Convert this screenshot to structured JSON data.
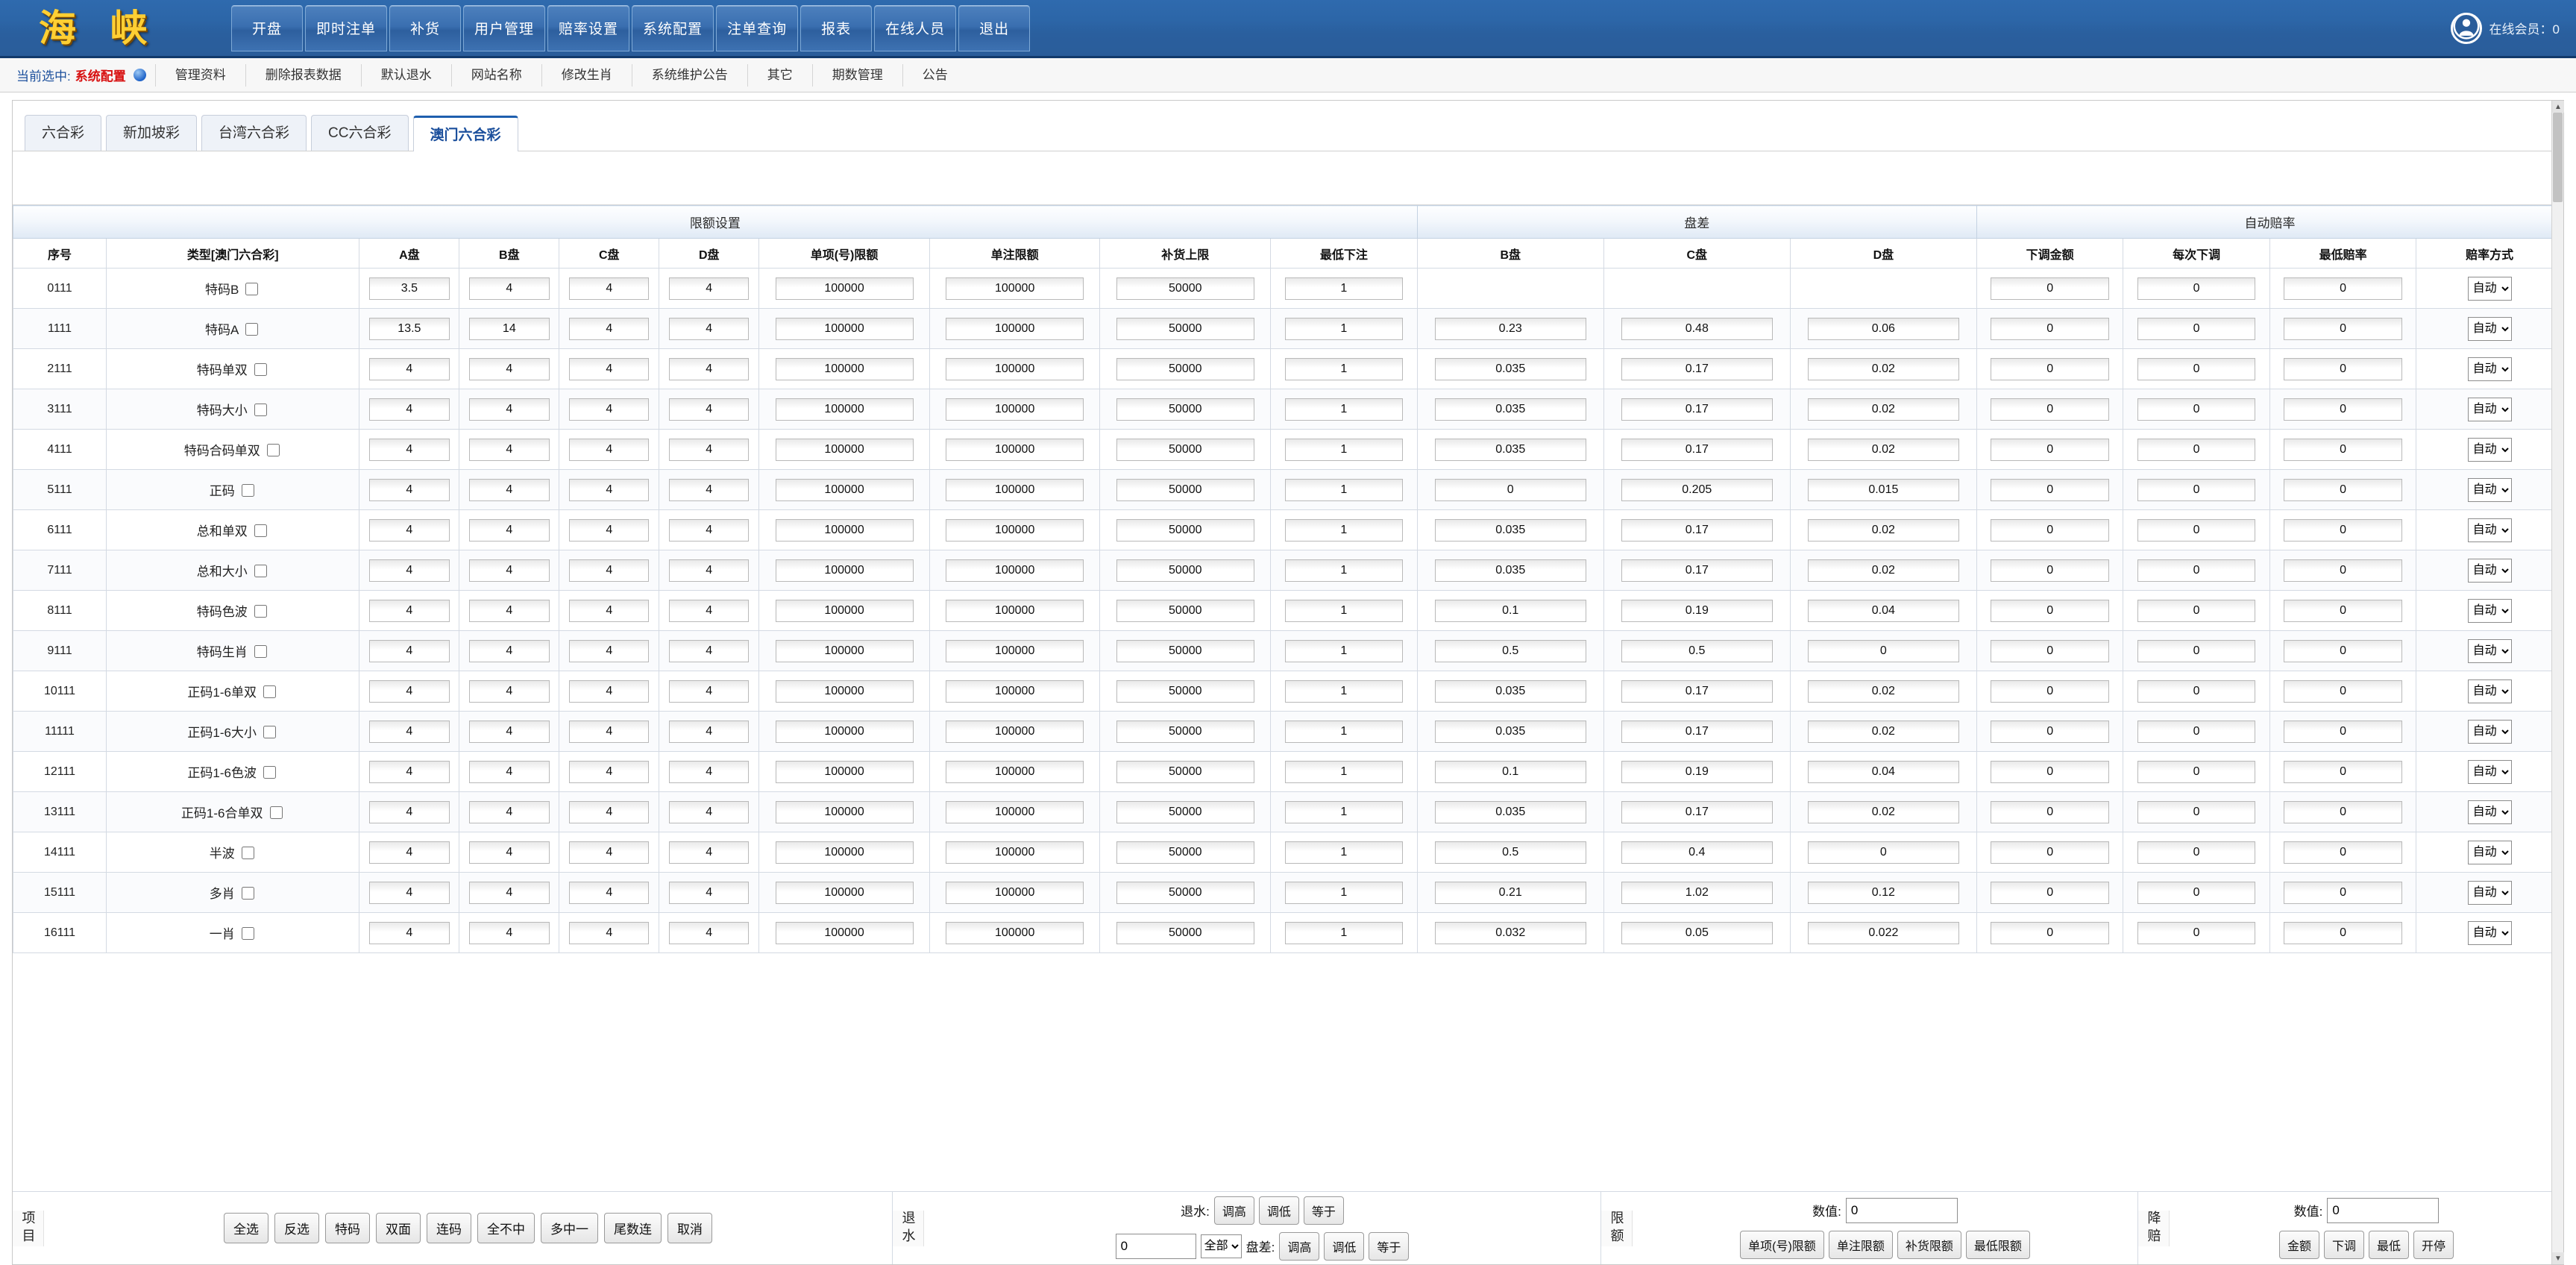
{
  "header": {
    "logo_text": "海 峡",
    "nav": [
      {
        "label": "开盘"
      },
      {
        "label": "即时注单"
      },
      {
        "label": "补货"
      },
      {
        "label": "用户管理"
      },
      {
        "label": "赔率设置"
      },
      {
        "label": "系统配置"
      },
      {
        "label": "注单查询"
      },
      {
        "label": "报表"
      },
      {
        "label": "在线人员"
      },
      {
        "label": "退出"
      }
    ],
    "online_label": "在线会员：0",
    "avatar_icon": "user-avatar-icon"
  },
  "subnav": {
    "current_label": "当前选中:",
    "current_value": "系统配置",
    "items": [
      {
        "label": "管理资料"
      },
      {
        "label": "删除报表数据"
      },
      {
        "label": "默认退水"
      },
      {
        "label": "网站名称"
      },
      {
        "label": "修改生肖"
      },
      {
        "label": "系统维护公告"
      },
      {
        "label": "其它"
      },
      {
        "label": "期数管理"
      },
      {
        "label": "公告"
      }
    ]
  },
  "tabs": [
    {
      "label": "六合彩",
      "active": false
    },
    {
      "label": "新加坡彩",
      "active": false
    },
    {
      "label": "台湾六合彩",
      "active": false
    },
    {
      "label": "CC六合彩",
      "active": false
    },
    {
      "label": "澳门六合彩",
      "active": true
    }
  ],
  "table": {
    "group_headers": [
      {
        "label": "限额设置",
        "span": 10
      },
      {
        "label": "盘差",
        "span": 3
      },
      {
        "label": "自动赔率",
        "span": 4
      }
    ],
    "columns": [
      "序号",
      "类型[澳门六合彩]",
      "A盘",
      "B盘",
      "C盘",
      "D盘",
      "单项(号)限额",
      "单注限额",
      "补货上限",
      "最低下注",
      "B盘",
      "C盘",
      "D盘",
      "下调金额",
      "每次下调",
      "最低赔率",
      "赔率方式"
    ],
    "mode_options": [
      "自动"
    ],
    "rows": [
      {
        "id": "0111",
        "type": "特码B",
        "a": "3.5",
        "b": "4",
        "c": "4",
        "d": "4",
        "single_item": "100000",
        "single_bet": "100000",
        "restock": "50000",
        "min_bet": "1",
        "pb": "",
        "pc": "",
        "pd": "",
        "down_amt": "0",
        "each_down": "0",
        "min_odds": "0",
        "mode": "自动"
      },
      {
        "id": "1111",
        "type": "特码A",
        "a": "13.5",
        "b": "14",
        "c": "4",
        "d": "4",
        "single_item": "100000",
        "single_bet": "100000",
        "restock": "50000",
        "min_bet": "1",
        "pb": "0.23",
        "pc": "0.48",
        "pd": "0.06",
        "down_amt": "0",
        "each_down": "0",
        "min_odds": "0",
        "mode": "自动"
      },
      {
        "id": "2111",
        "type": "特码单双",
        "a": "4",
        "b": "4",
        "c": "4",
        "d": "4",
        "single_item": "100000",
        "single_bet": "100000",
        "restock": "50000",
        "min_bet": "1",
        "pb": "0.035",
        "pc": "0.17",
        "pd": "0.02",
        "down_amt": "0",
        "each_down": "0",
        "min_odds": "0",
        "mode": "自动"
      },
      {
        "id": "3111",
        "type": "特码大小",
        "a": "4",
        "b": "4",
        "c": "4",
        "d": "4",
        "single_item": "100000",
        "single_bet": "100000",
        "restock": "50000",
        "min_bet": "1",
        "pb": "0.035",
        "pc": "0.17",
        "pd": "0.02",
        "down_amt": "0",
        "each_down": "0",
        "min_odds": "0",
        "mode": "自动"
      },
      {
        "id": "4111",
        "type": "特码合码单双",
        "a": "4",
        "b": "4",
        "c": "4",
        "d": "4",
        "single_item": "100000",
        "single_bet": "100000",
        "restock": "50000",
        "min_bet": "1",
        "pb": "0.035",
        "pc": "0.17",
        "pd": "0.02",
        "down_amt": "0",
        "each_down": "0",
        "min_odds": "0",
        "mode": "自动"
      },
      {
        "id": "5111",
        "type": "正码",
        "a": "4",
        "b": "4",
        "c": "4",
        "d": "4",
        "single_item": "100000",
        "single_bet": "100000",
        "restock": "50000",
        "min_bet": "1",
        "pb": "0",
        "pc": "0.205",
        "pd": "0.015",
        "down_amt": "0",
        "each_down": "0",
        "min_odds": "0",
        "mode": "自动"
      },
      {
        "id": "6111",
        "type": "总和单双",
        "a": "4",
        "b": "4",
        "c": "4",
        "d": "4",
        "single_item": "100000",
        "single_bet": "100000",
        "restock": "50000",
        "min_bet": "1",
        "pb": "0.035",
        "pc": "0.17",
        "pd": "0.02",
        "down_amt": "0",
        "each_down": "0",
        "min_odds": "0",
        "mode": "自动"
      },
      {
        "id": "7111",
        "type": "总和大小",
        "a": "4",
        "b": "4",
        "c": "4",
        "d": "4",
        "single_item": "100000",
        "single_bet": "100000",
        "restock": "50000",
        "min_bet": "1",
        "pb": "0.035",
        "pc": "0.17",
        "pd": "0.02",
        "down_amt": "0",
        "each_down": "0",
        "min_odds": "0",
        "mode": "自动"
      },
      {
        "id": "8111",
        "type": "特码色波",
        "a": "4",
        "b": "4",
        "c": "4",
        "d": "4",
        "single_item": "100000",
        "single_bet": "100000",
        "restock": "50000",
        "min_bet": "1",
        "pb": "0.1",
        "pc": "0.19",
        "pd": "0.04",
        "down_amt": "0",
        "each_down": "0",
        "min_odds": "0",
        "mode": "自动"
      },
      {
        "id": "9111",
        "type": "特码生肖",
        "a": "4",
        "b": "4",
        "c": "4",
        "d": "4",
        "single_item": "100000",
        "single_bet": "100000",
        "restock": "50000",
        "min_bet": "1",
        "pb": "0.5",
        "pc": "0.5",
        "pd": "0",
        "down_amt": "0",
        "each_down": "0",
        "min_odds": "0",
        "mode": "自动"
      },
      {
        "id": "10111",
        "type": "正码1-6单双",
        "a": "4",
        "b": "4",
        "c": "4",
        "d": "4",
        "single_item": "100000",
        "single_bet": "100000",
        "restock": "50000",
        "min_bet": "1",
        "pb": "0.035",
        "pc": "0.17",
        "pd": "0.02",
        "down_amt": "0",
        "each_down": "0",
        "min_odds": "0",
        "mode": "自动"
      },
      {
        "id": "11111",
        "type": "正码1-6大小",
        "a": "4",
        "b": "4",
        "c": "4",
        "d": "4",
        "single_item": "100000",
        "single_bet": "100000",
        "restock": "50000",
        "min_bet": "1",
        "pb": "0.035",
        "pc": "0.17",
        "pd": "0.02",
        "down_amt": "0",
        "each_down": "0",
        "min_odds": "0",
        "mode": "自动"
      },
      {
        "id": "12111",
        "type": "正码1-6色波",
        "a": "4",
        "b": "4",
        "c": "4",
        "d": "4",
        "single_item": "100000",
        "single_bet": "100000",
        "restock": "50000",
        "min_bet": "1",
        "pb": "0.1",
        "pc": "0.19",
        "pd": "0.04",
        "down_amt": "0",
        "each_down": "0",
        "min_odds": "0",
        "mode": "自动"
      },
      {
        "id": "13111",
        "type": "正码1-6合单双",
        "a": "4",
        "b": "4",
        "c": "4",
        "d": "4",
        "single_item": "100000",
        "single_bet": "100000",
        "restock": "50000",
        "min_bet": "1",
        "pb": "0.035",
        "pc": "0.17",
        "pd": "0.02",
        "down_amt": "0",
        "each_down": "0",
        "min_odds": "0",
        "mode": "自动"
      },
      {
        "id": "14111",
        "type": "半波",
        "a": "4",
        "b": "4",
        "c": "4",
        "d": "4",
        "single_item": "100000",
        "single_bet": "100000",
        "restock": "50000",
        "min_bet": "1",
        "pb": "0.5",
        "pc": "0.4",
        "pd": "0",
        "down_amt": "0",
        "each_down": "0",
        "min_odds": "0",
        "mode": "自动"
      },
      {
        "id": "15111",
        "type": "多肖",
        "a": "4",
        "b": "4",
        "c": "4",
        "d": "4",
        "single_item": "100000",
        "single_bet": "100000",
        "restock": "50000",
        "min_bet": "1",
        "pb": "0.21",
        "pc": "1.02",
        "pd": "0.12",
        "down_amt": "0",
        "each_down": "0",
        "min_odds": "0",
        "mode": "自动"
      },
      {
        "id": "16111",
        "type": "一肖",
        "a": "4",
        "b": "4",
        "c": "4",
        "d": "4",
        "single_item": "100000",
        "single_bet": "100000",
        "restock": "50000",
        "min_bet": "1",
        "pb": "0.032",
        "pc": "0.05",
        "pd": "0.022",
        "down_amt": "0",
        "each_down": "0",
        "min_odds": "0",
        "mode": "自动"
      }
    ]
  },
  "bottombar": {
    "items_section": {
      "vlabel": "项目",
      "buttons": [
        "全选",
        "反选",
        "特码",
        "双面",
        "连码",
        "全不中",
        "多中一",
        "尾数连",
        "取消"
      ]
    },
    "water_section": {
      "vlabel": "退水",
      "row1_label": "退水:",
      "row1_buttons": [
        "调高",
        "调低",
        "等于"
      ],
      "input_value": "0",
      "select_value": "全部",
      "select_options": [
        "全部"
      ],
      "row2_label": "盘差:",
      "row2_buttons": [
        "调高",
        "调低",
        "等于"
      ]
    },
    "limit_section": {
      "vlabel": "限额",
      "value_label": "数值:",
      "input_value": "0",
      "buttons": [
        "单项(号)限额",
        "单注限额",
        "补货限额",
        "最低限额"
      ]
    },
    "reduce_section": {
      "vlabel": "降赔",
      "value_label": "数值:",
      "input_value": "0",
      "buttons": [
        "金额",
        "下调",
        "最低",
        "开停"
      ]
    }
  }
}
